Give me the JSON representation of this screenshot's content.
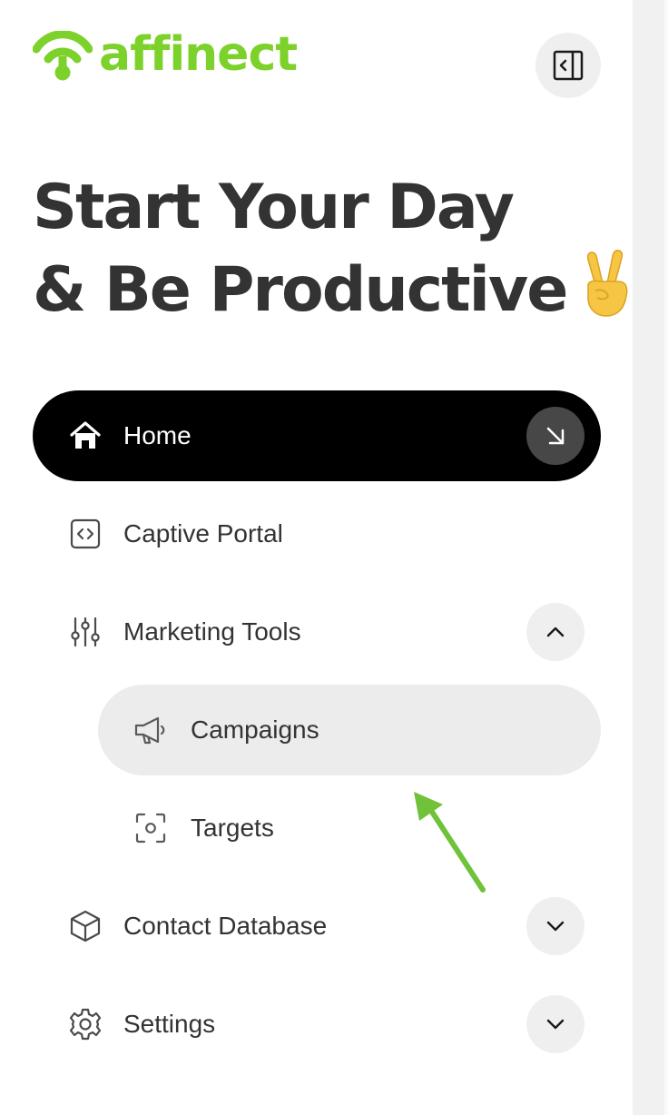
{
  "brand": {
    "name": "affinect",
    "color": "#7cd12a",
    "logo_icon": "wifi-signal-icon"
  },
  "header": {
    "collapse_icon": "sidebar-collapse-icon"
  },
  "headline": {
    "line1": "Start Your Day",
    "line2": "& Be Productive",
    "emoji": "victory-hand-emoji"
  },
  "nav": {
    "home": {
      "label": "Home",
      "icon": "home-icon",
      "action_icon": "arrow-down-right-icon",
      "active": true
    },
    "captive_portal": {
      "label": "Captive Portal",
      "icon": "code-box-icon"
    },
    "marketing_tools": {
      "label": "Marketing Tools",
      "icon": "sliders-icon",
      "expanded": true,
      "toggle_icon": "chevron-up-icon",
      "children": [
        {
          "label": "Campaigns",
          "icon": "megaphone-icon",
          "selected": true
        },
        {
          "label": "Targets",
          "icon": "target-scan-icon"
        }
      ]
    },
    "contact_database": {
      "label": "Contact Database",
      "icon": "cube-icon",
      "toggle_icon": "chevron-down-icon"
    },
    "settings": {
      "label": "Settings",
      "icon": "gear-icon",
      "toggle_icon": "chevron-down-icon"
    }
  },
  "annotation": {
    "type": "green-arrow",
    "color": "#6fc23a"
  }
}
